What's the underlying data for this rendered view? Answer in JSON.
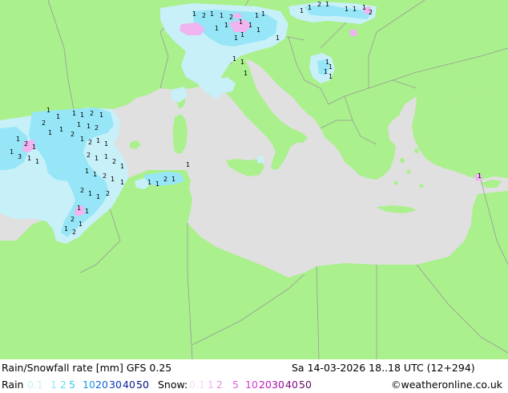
{
  "title": "Rain/Snowfall rate [mm] GFS 0.25",
  "datetime": "Sa 14-03-2026 18..18 UTC (12+294)",
  "legend": {
    "rain_label": "Rain",
    "rain_steps": [
      {
        "text": "0.1",
        "color": "#c8f0f8"
      },
      {
        "text": "1",
        "color": "#96e6f8"
      },
      {
        "text": "2",
        "color": "#64dcf8"
      },
      {
        "text": "5",
        "color": "#32c8f0"
      },
      {
        "text": "10",
        "color": "#1e96e6"
      },
      {
        "text": "20",
        "color": "#1464d2"
      },
      {
        "text": "30",
        "color": "#0a32be"
      },
      {
        "text": "40",
        "color": "#0a1e9b"
      },
      {
        "text": "50",
        "color": "#000a78"
      }
    ],
    "snow_label": "Snow:",
    "snow_steps": [
      {
        "text": "0.1",
        "color": "#f8dcf8"
      },
      {
        "text": "1",
        "color": "#f0b4f0"
      },
      {
        "text": "2",
        "color": "#e68ce6"
      },
      {
        "text": "5",
        "color": "#dc64dc"
      },
      {
        "text": "10",
        "color": "#d23cd2"
      },
      {
        "text": "20",
        "color": "#be14be"
      },
      {
        "text": "30",
        "color": "#a00aa0"
      },
      {
        "text": "40",
        "color": "#820a82"
      },
      {
        "text": "50",
        "color": "#640a64"
      }
    ]
  },
  "credit": "©weatheronline.co.uk",
  "colors": {
    "land": "#aaf08c",
    "sea": "#e0e0e0",
    "border": "#9a9a9a",
    "rain_light": "#c8f0f8",
    "rain_mid": "#96e6f8",
    "snow": "#f0b4f0"
  }
}
